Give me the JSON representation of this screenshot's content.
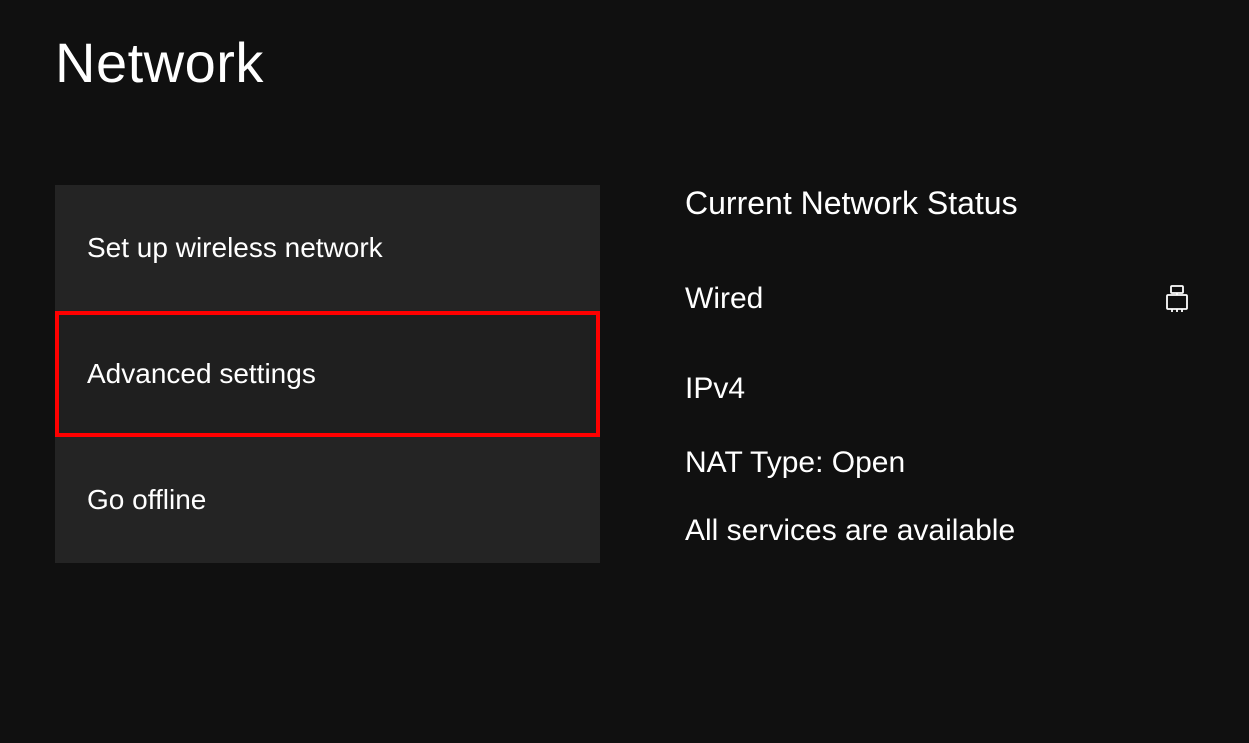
{
  "page": {
    "title": "Network"
  },
  "menu": {
    "items": [
      {
        "label": "Set up wireless network",
        "highlighted": false
      },
      {
        "label": "Advanced settings",
        "highlighted": true
      },
      {
        "label": "Go offline",
        "highlighted": false
      }
    ]
  },
  "status": {
    "heading": "Current Network Status",
    "connection_type": "Wired",
    "ip_protocol": "IPv4",
    "nat_type": "NAT Type: Open",
    "services": "All services are available"
  }
}
